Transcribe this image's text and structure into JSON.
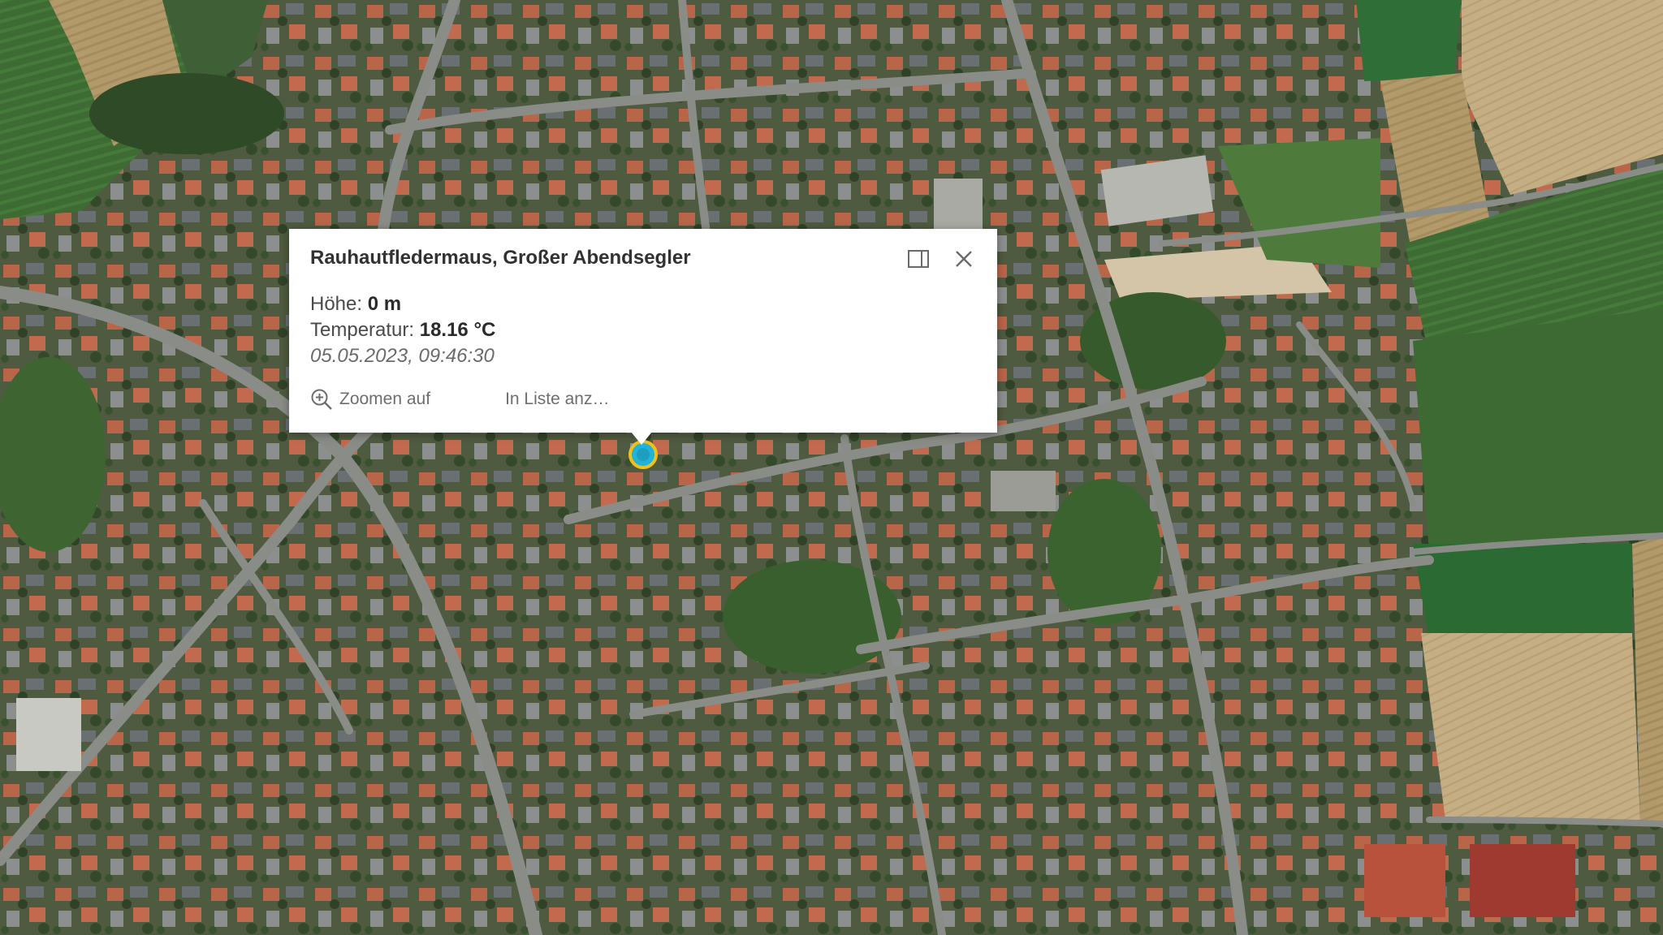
{
  "popup": {
    "title": "Rauhautfledermaus, Großer Abendsegler",
    "fields": [
      {
        "label": "Höhe: ",
        "value": "0 m"
      },
      {
        "label": "Temperatur: ",
        "value": "18.16 °C"
      }
    ],
    "timestamp": "05.05.2023, 09:46:30",
    "actions": {
      "zoom_label": "Zoomen auf",
      "list_label": "In Liste anz…"
    },
    "icons": {
      "dock": "dock-icon",
      "close": "close-icon",
      "zoom": "zoom-in-icon"
    }
  },
  "map": {
    "marker_color": "#21b4d6",
    "marker_ring": "#f0c11a"
  }
}
